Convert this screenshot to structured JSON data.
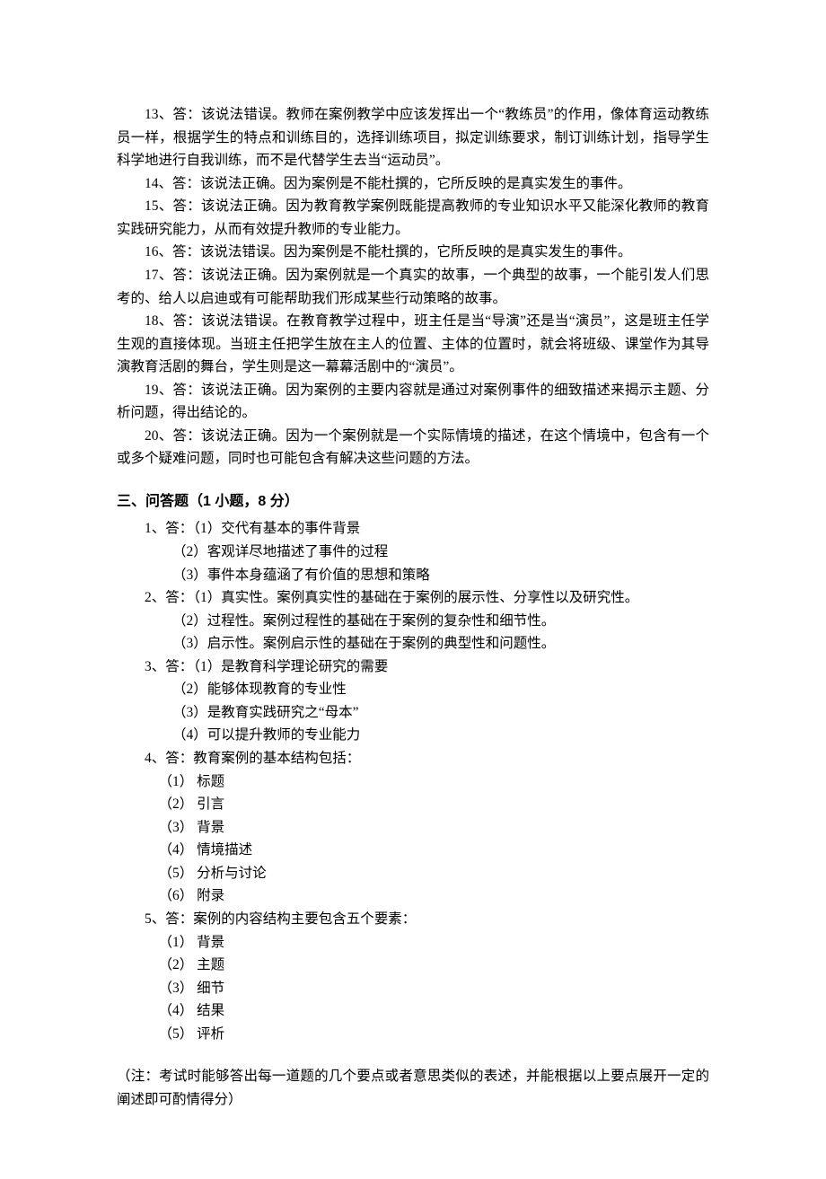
{
  "judgments": {
    "j13": "13、答：该说法错误。教师在案例教学中应该发挥出一个“教练员”的作用，像体育运动教练员一样，根据学生的特点和训练目的，选择训练项目，拟定训练要求，制订训练计划，指导学生科学地进行自我训练，而不是代替学生去当“运动员”。",
    "j14": "14、答：该说法正确。因为案例是不能杜撰的，它所反映的是真实发生的事件。",
    "j15": "15、答：该说法正确。因为教育教学案例既能提高教师的专业知识水平又能深化教师的教育实践研究能力，从而有效提升教师的专业能力。",
    "j16": "16、答：该说法错误。因为案例是不能杜撰的，它所反映的是真实发生的事件。",
    "j17": "17、答：该说法正确。因为案例就是一个真实的故事，一个典型的故事，一个能引发人们思考的、给人以启迪或有可能帮助我们形成某些行动策略的故事。",
    "j18": "18、答：该说法错误。在教育教学过程中，班主任是当“导演”还是当“演员”，这是班主任学生观的直接体现。当班主任把学生放在主人的位置、主体的位置时，就会将班级、课堂作为其导演教育活剧的舞台，学生则是这一幕幕活剧中的“演员”。",
    "j19": "19、答：该说法正确。因为案例的主要内容就是通过对案例事件的细致描述来揭示主题、分析问题，得出结论的。",
    "j20": "20、答：该说法正确。因为一个案例就是一个实际情境的描述，在这个情境中，包含有一个或多个疑难问题，同时也可能包含有解决这些问题的方法。"
  },
  "section3_title": "三、问答题（1 小题，8 分）",
  "qas": {
    "q1": {
      "head": "1、答：（1）交代有基本的事件背景",
      "subs": [
        "（2）客观详尽地描述了事件的过程",
        "（3）事件本身蕴涵了有价值的思想和策略"
      ]
    },
    "q2": {
      "head": "2、答：（1）真实性。案例真实性的基础在于案例的展示性、分享性以及研究性。",
      "subs": [
        "（2）过程性。案例过程性的基础在于案例的复杂性和细节性。",
        "（3）启示性。案例启示性的基础在于案例的典型性和问题性。"
      ]
    },
    "q3": {
      "head": "3、答：（1）是教育科学理论研究的需要",
      "subs": [
        "（2）能够体现教育的专业性",
        "（3）是教育实践研究之“母本”",
        "（4）可以提升教师的专业能力"
      ]
    },
    "q4": {
      "head": "4、答：教育案例的基本结构包括：",
      "subs": [
        "（1）  标题",
        "（2）  引言",
        "（3）  背景",
        "（4）  情境描述",
        "（5）  分析与讨论",
        "（6）  附录"
      ]
    },
    "q5": {
      "head": "5、答：案例的内容结构主要包含五个要素：",
      "subs": [
        "（1）  背景",
        "（2）  主题",
        "（3）  细节",
        "（4）  结果",
        "（5）  评析"
      ]
    }
  },
  "note": "（注：考试时能够答出每一道题的几个要点或者意思类似的表述，并能根据以上要点展开一定的阐述即可酌情得分）"
}
